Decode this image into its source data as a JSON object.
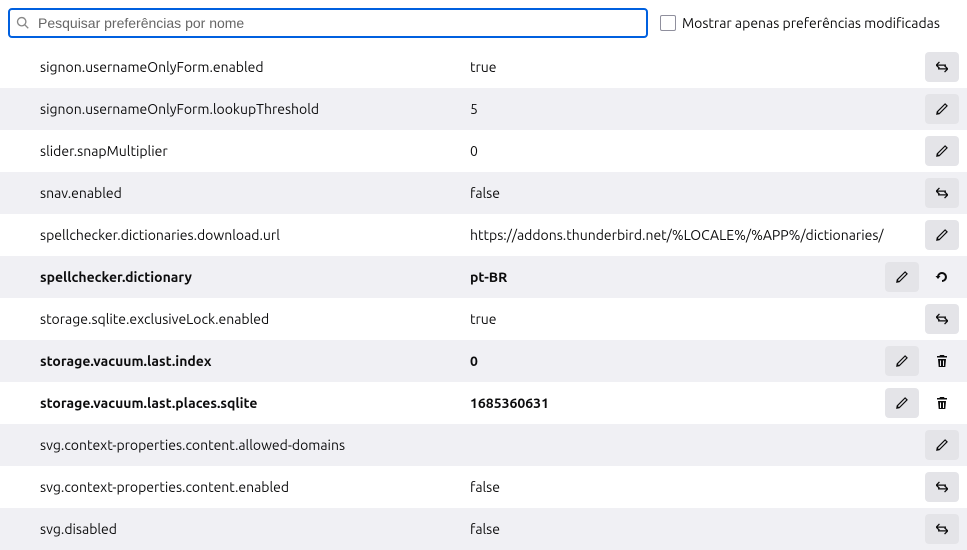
{
  "search": {
    "placeholder": "Pesquisar preferências por nome"
  },
  "checkbox": {
    "label": "Mostrar apenas preferências modificadas"
  },
  "rows": [
    {
      "name": "signon.usernameOnlyForm.enabled",
      "value": "true",
      "modified": false,
      "striped": false,
      "action": "toggle"
    },
    {
      "name": "signon.usernameOnlyForm.lookupThreshold",
      "value": "5",
      "modified": false,
      "striped": true,
      "action": "edit"
    },
    {
      "name": "slider.snapMultiplier",
      "value": "0",
      "modified": false,
      "striped": false,
      "action": "edit"
    },
    {
      "name": "snav.enabled",
      "value": "false",
      "modified": false,
      "striped": true,
      "action": "toggle"
    },
    {
      "name": "spellchecker.dictionaries.download.url",
      "value": "https://addons.thunderbird.net/%LOCALE%/%APP%/dictionaries/",
      "modified": false,
      "striped": false,
      "action": "edit"
    },
    {
      "name": "spellchecker.dictionary",
      "value": "pt-BR",
      "modified": true,
      "striped": true,
      "action": "edit",
      "secondary": "reset"
    },
    {
      "name": "storage.sqlite.exclusiveLock.enabled",
      "value": "true",
      "modified": false,
      "striped": false,
      "action": "toggle"
    },
    {
      "name": "storage.vacuum.last.index",
      "value": "0",
      "modified": true,
      "striped": true,
      "action": "edit",
      "secondary": "delete"
    },
    {
      "name": "storage.vacuum.last.places.sqlite",
      "value": "1685360631",
      "modified": true,
      "striped": false,
      "action": "edit",
      "secondary": "delete"
    },
    {
      "name": "svg.context-properties.content.allowed-domains",
      "value": "",
      "modified": false,
      "striped": true,
      "action": "edit"
    },
    {
      "name": "svg.context-properties.content.enabled",
      "value": "false",
      "modified": false,
      "striped": false,
      "action": "toggle"
    },
    {
      "name": "svg.disabled",
      "value": "false",
      "modified": false,
      "striped": true,
      "action": "toggle"
    }
  ]
}
